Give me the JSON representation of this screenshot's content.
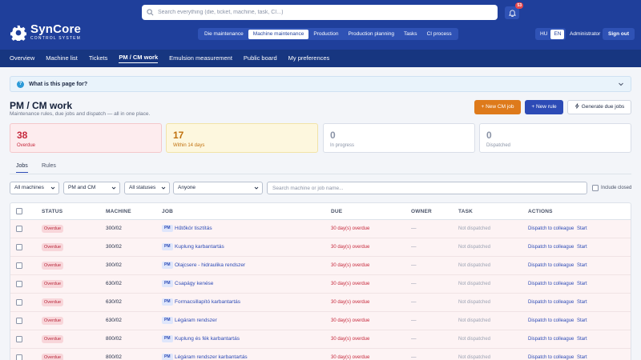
{
  "app": {
    "brand_name": "SynCore",
    "brand_sub": "CONTROL SYSTEM"
  },
  "header": {
    "search_placeholder": "Search everything (die, ticket, machine, task, CI...)",
    "notifications_count": "53",
    "modules": [
      "Die maintenance",
      "Machine maintenance",
      "Production",
      "Production planning",
      "Tasks",
      "CI process"
    ],
    "active_module": "Machine maintenance",
    "languages": [
      "HU",
      "EN"
    ],
    "active_language": "EN",
    "user": "Administrator",
    "sign_out": "Sign out"
  },
  "subnav": {
    "items": [
      "Overview",
      "Machine list",
      "Tickets",
      "PM / CM work",
      "Emulsion measurement",
      "Public board",
      "My preferences"
    ],
    "active": "PM / CM work"
  },
  "info": {
    "title": "What is this page for?"
  },
  "page": {
    "title": "PM / CM work",
    "subtitle": "Maintenance rules, due jobs and dispatch — all in one place.",
    "new_cm_label": "+ New CM job",
    "new_rule_label": "+ New rule",
    "generate_label": "Generate due jobs"
  },
  "kpis": [
    {
      "value": "38",
      "label": "Overdue",
      "tone": "red"
    },
    {
      "value": "17",
      "label": "Within 14 days",
      "tone": "yellow"
    },
    {
      "value": "0",
      "label": "In progress",
      "tone": "neutral"
    },
    {
      "value": "0",
      "label": "Dispatched",
      "tone": "neutral"
    }
  ],
  "tabs": {
    "jobs": "Jobs",
    "rules": "Rules",
    "active": "Jobs"
  },
  "filters": {
    "machines": "All machines",
    "type": "PM and CM",
    "status": "All statuses",
    "assignee": "Anyone",
    "search_placeholder": "Search machine or job name...",
    "include_closed": "Include closed"
  },
  "table": {
    "headers": {
      "status": "STATUS",
      "machine": "MACHINE",
      "job": "JOB",
      "due": "DUE",
      "owner": "OWNER",
      "task": "TASK",
      "actions": "ACTIONS"
    },
    "rows": [
      {
        "status": "Overdue",
        "machine": "300/02",
        "type": "PM",
        "job": "Hűtőkör tisztítás",
        "due": "30 day(s) overdue",
        "owner": "—",
        "task": "Not dispatched",
        "dispatch": "Dispatch to colleague",
        "start": "Start"
      },
      {
        "status": "Overdue",
        "machine": "300/02",
        "type": "PM",
        "job": "Kuplung karbantartás",
        "due": "30 day(s) overdue",
        "owner": "—",
        "task": "Not dispatched",
        "dispatch": "Dispatch to colleague",
        "start": "Start"
      },
      {
        "status": "Overdue",
        "machine": "300/02",
        "type": "PM",
        "job": "Olajcsere - hidraulika rendszer",
        "due": "30 day(s) overdue",
        "owner": "—",
        "task": "Not dispatched",
        "dispatch": "Dispatch to colleague",
        "start": "Start"
      },
      {
        "status": "Overdue",
        "machine": "630/02",
        "type": "PM",
        "job": "Csapágy kenése",
        "due": "30 day(s) overdue",
        "owner": "—",
        "task": "Not dispatched",
        "dispatch": "Dispatch to colleague",
        "start": "Start"
      },
      {
        "status": "Overdue",
        "machine": "630/02",
        "type": "PM",
        "job": "Formacsillapító karbantartás",
        "due": "30 day(s) overdue",
        "owner": "—",
        "task": "Not dispatched",
        "dispatch": "Dispatch to colleague",
        "start": "Start"
      },
      {
        "status": "Overdue",
        "machine": "630/02",
        "type": "PM",
        "job": "Légáram rendszer",
        "due": "30 day(s) overdue",
        "owner": "—",
        "task": "Not dispatched",
        "dispatch": "Dispatch to colleague",
        "start": "Start"
      },
      {
        "status": "Overdue",
        "machine": "800/02",
        "type": "PM",
        "job": "Kuplung és fék karbantartás",
        "due": "30 day(s) overdue",
        "owner": "—",
        "task": "Not dispatched",
        "dispatch": "Dispatch to colleague",
        "start": "Start"
      },
      {
        "status": "Overdue",
        "machine": "800/02",
        "type": "PM",
        "job": "Légáram rendszer karbantartás",
        "due": "30 day(s) overdue",
        "owner": "—",
        "task": "Not dispatched",
        "dispatch": "Dispatch to colleague",
        "start": "Start"
      }
    ]
  }
}
